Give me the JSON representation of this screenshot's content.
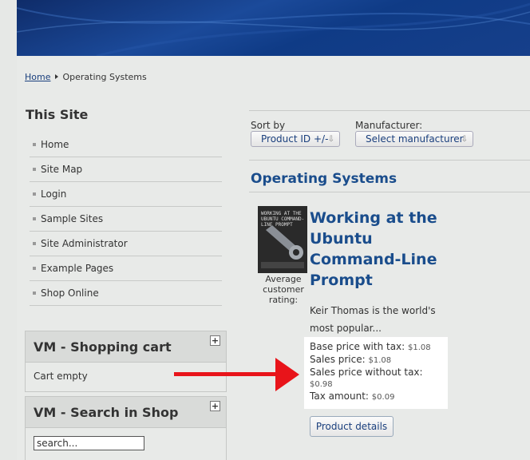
{
  "breadcrumb": {
    "home": "Home",
    "current": "Operating Systems"
  },
  "site_module": {
    "title": "This Site",
    "items": [
      {
        "label": "Home"
      },
      {
        "label": "Site Map"
      },
      {
        "label": "Login"
      },
      {
        "label": "Sample Sites"
      },
      {
        "label": "Site Administrator"
      },
      {
        "label": "Example Pages"
      },
      {
        "label": "Shop Online"
      }
    ]
  },
  "cart": {
    "title": "VM - Shopping cart",
    "toggle": "+",
    "status": "Cart empty"
  },
  "search": {
    "title": "VM - Search in Shop",
    "toggle": "+",
    "value": "search..."
  },
  "sorting": {
    "sort_label": "Sort by",
    "sort_value": "Product ID +/-",
    "manufacturer_label": "Manufacturer:",
    "manufacturer_value": "Select manufacturer"
  },
  "category": {
    "title": "Operating Systems"
  },
  "product": {
    "name": "Working at the Ubuntu Command-Line Prompt",
    "cover_text": "WORKING AT THE UBUNTU COMMAND-LINE PROMPT",
    "rating_label": "Average customer rating:",
    "description": "Keir Thomas is the world's most popular...",
    "prices": {
      "base_label": "Base price with tax:",
      "base_value": "$1.08",
      "sales_label": "Sales price:",
      "sales_value": "$1.08",
      "sales_no_tax_label": "Sales price without tax:",
      "sales_no_tax_value": "$0.98",
      "tax_label": "Tax amount:",
      "tax_value": "$0.09"
    },
    "details_button": "Product details"
  },
  "colors": {
    "accent": "#1a4d8c",
    "banner": "#163f8a",
    "arrow": "#e8141a"
  }
}
